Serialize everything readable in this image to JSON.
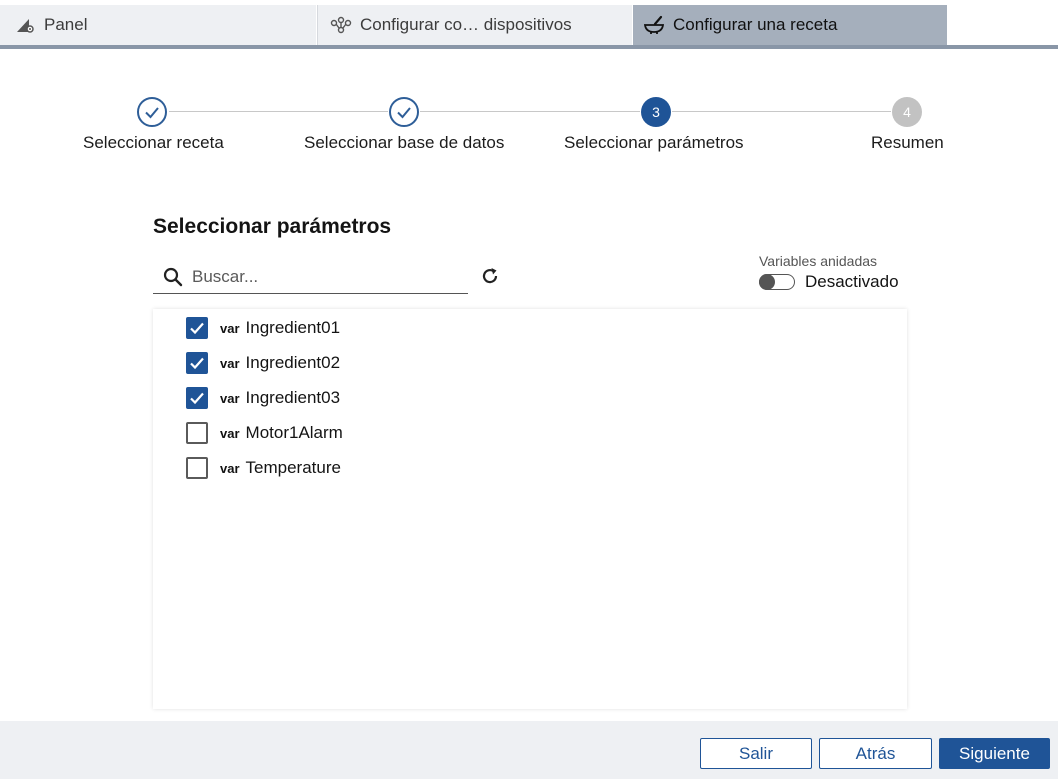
{
  "tabs": [
    {
      "label": "Panel",
      "icon": "panel-wrench-icon"
    },
    {
      "label": "Configurar co… dispositivos",
      "icon": "devices-network-icon"
    },
    {
      "label": "Configurar una receta",
      "icon": "mortar-pestle-icon",
      "active": true
    }
  ],
  "stepper": {
    "steps": [
      {
        "label": "Seleccionar receta",
        "state": "done"
      },
      {
        "label": "Seleccionar base de datos",
        "state": "done"
      },
      {
        "label": "Seleccionar parámetros",
        "state": "active",
        "number": "3"
      },
      {
        "label": "Resumen",
        "state": "pending",
        "number": "4"
      }
    ]
  },
  "main": {
    "title": "Seleccionar parámetros",
    "search": {
      "placeholder": "Buscar...",
      "value": ""
    },
    "nested_variables": {
      "label": "Variables anidadas",
      "state": "Desactivado"
    },
    "items": [
      {
        "tag": "var",
        "name": "Ingredient01",
        "checked": true
      },
      {
        "tag": "var",
        "name": "Ingredient02",
        "checked": true
      },
      {
        "tag": "var",
        "name": "Ingredient03",
        "checked": true
      },
      {
        "tag": "var",
        "name": "Motor1Alarm",
        "checked": false
      },
      {
        "tag": "var",
        "name": "Temperature",
        "checked": false
      }
    ]
  },
  "footer": {
    "exit_label": "Salir",
    "back_label": "Atrás",
    "next_label": "Siguiente"
  },
  "colors": {
    "accent": "#1f5497",
    "tab_active": "#a5afbc",
    "tab_bg": "#eef0f3",
    "pending": "#c2c2c2"
  }
}
